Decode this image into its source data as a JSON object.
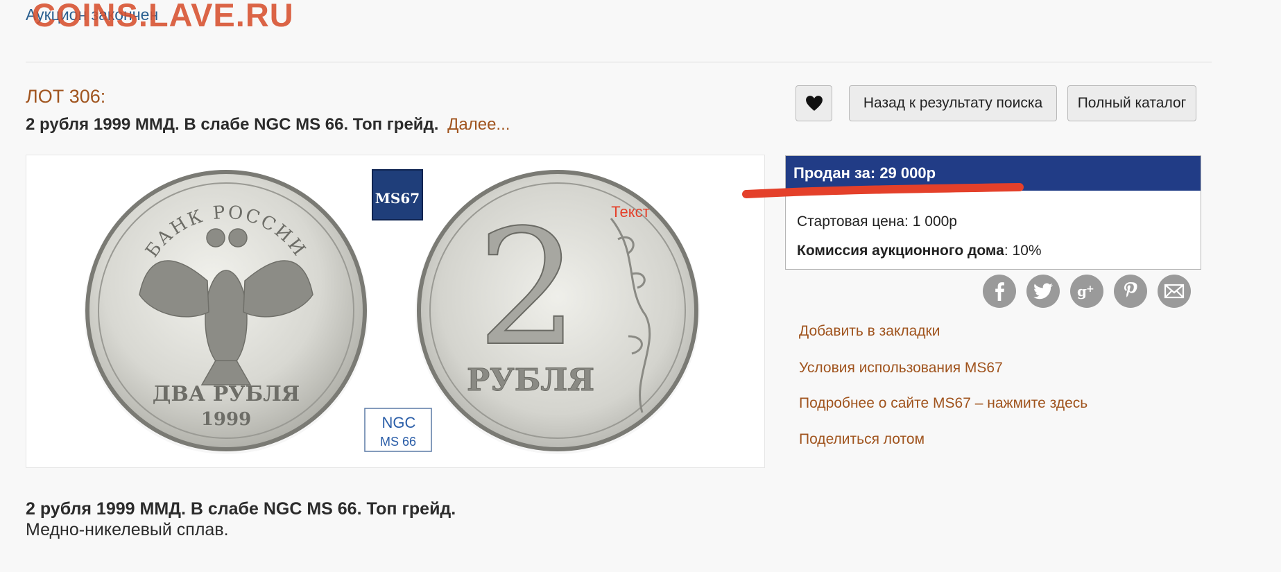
{
  "watermark": "COINS.LAVE.RU",
  "status_link": "Аукцион закончен",
  "lot": {
    "number": "ЛОТ 306:",
    "title": "2 рубля 1999 ММД. В слабе NGC MS 66. Топ грейд.",
    "more_link": "Далее..."
  },
  "buttons": {
    "back": "Назад к результату поиска",
    "catalog": "Полный каталог"
  },
  "image": {
    "obverse_top": "БАНК РОССИИ",
    "obverse_bottom": "ДВА РУБЛЯ",
    "obverse_year": "1999",
    "reverse_denomination": "2",
    "reverse_text": "РУБЛЯ",
    "badge_ms67": "MS67",
    "ngc_brand": "NGC",
    "ngc_grade": "MS 66",
    "annotation": "Текст"
  },
  "price": {
    "sold": "Продан за: 29 000р",
    "start_label": "Стартовая цена:",
    "start_value": "1 000р",
    "commission_label": "Комиссия аукционного дома",
    "commission_value": ": 10%"
  },
  "social": [
    "facebook",
    "twitter",
    "google-plus",
    "pinterest",
    "email"
  ],
  "side_links": [
    "Добавить в закладки",
    "Условия использования MS67",
    "Подробнее о сайте MS67 – нажмите здесь",
    "Поделиться лотом"
  ],
  "description": {
    "title": "2 рубля 1999 ММД. В слабе NGC MS 66. Топ грейд.",
    "text": "Медно-никелевый сплав."
  },
  "colors": {
    "accent": "#a0541e",
    "header_blue": "#213c86",
    "watermark": "#d64e2c",
    "underline_red": "#e4402a"
  }
}
